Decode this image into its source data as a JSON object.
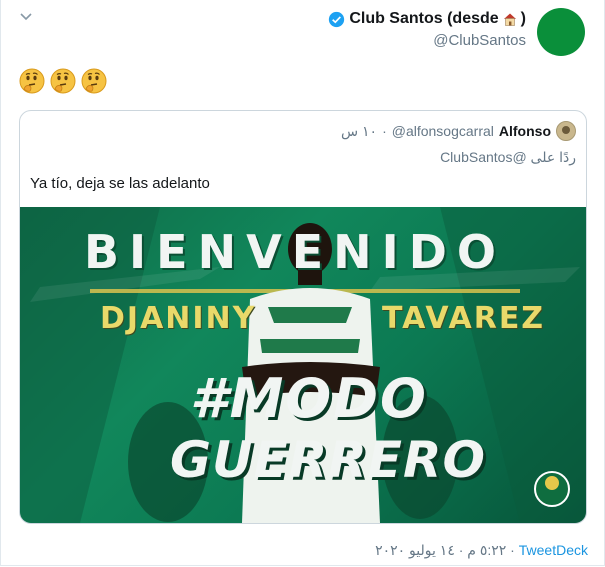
{
  "tweet": {
    "author_name": "Club Santos (desde",
    "author_name_close": ")",
    "author_handle": "@ClubSantos",
    "emojis": [
      "thinking-face",
      "thinking-face",
      "thinking-face"
    ],
    "timestamp": "٥:٢٢ م · ١٤ يوليو ٢٠٢٠",
    "source": "TweetDeck",
    "source_separator": " · "
  },
  "quoted": {
    "name": "Alfonso",
    "handle": "@alfonsogcarral",
    "time": "١٠ س",
    "reply_to": "ردًا على @ClubSantos",
    "text": "Ya tío, deja se las adelanto",
    "media": {
      "headline": "BIENVENIDO",
      "first_name": "DJANINY",
      "last_name": "TAVAREZ",
      "hashtag_line1": "#MODO",
      "hashtag_line2": "GUERRERO",
      "badge": "Santos"
    }
  },
  "colors": {
    "brand_green": "#0a8f3a",
    "verified_blue": "#1da1f2",
    "link_blue": "#1b95e0",
    "muted_gray": "#657786"
  }
}
